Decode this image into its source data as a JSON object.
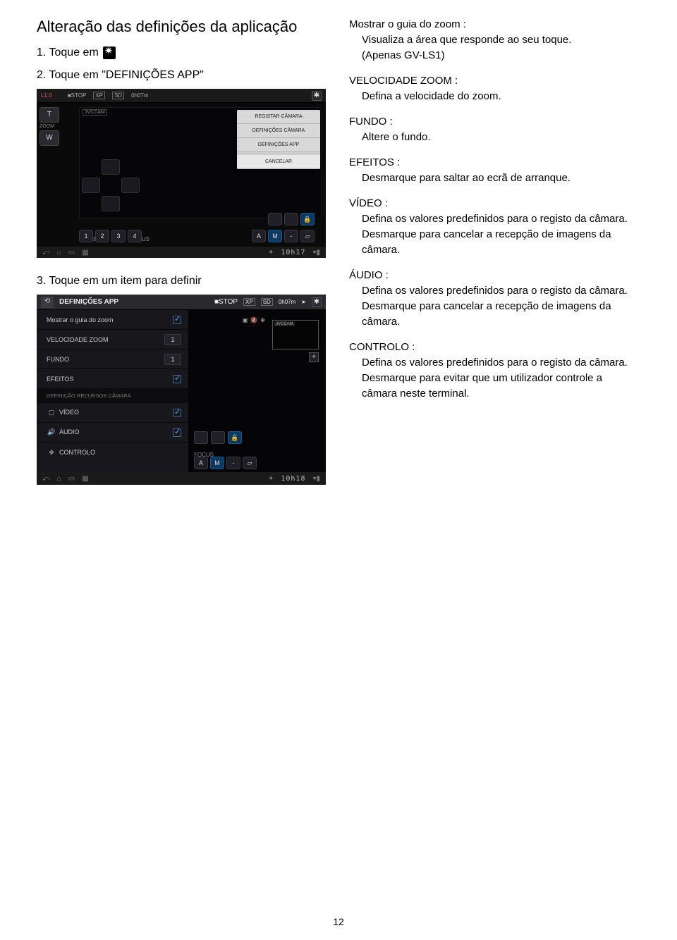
{
  "left": {
    "title": "Alteração das definições da aplicação",
    "step1_prefix": "1. Toque em",
    "step2": "2. Toque em \"DEFINIÇÕES APP\"",
    "step3": "3. Toque em um item para definir"
  },
  "shot1": {
    "topbar": {
      "l1": "L1.0",
      "stop": "■STOP",
      "xp": "XP",
      "sd": "SD",
      "t": "0h07m",
      "jvc": "JVCCAM"
    },
    "zoomT": "T",
    "zoomW": "W",
    "zoomLbl": "ZOOM",
    "preset": "PRESET",
    "focus": "FOCUS",
    "a": "A",
    "m": "M",
    "menu": {
      "reg": "REGISTAR CÂMARA",
      "camdef": "DEFINIÇÕES CÂMARA",
      "appdef": "DEFINIÇÕES APP",
      "cancel": "CANCELAR"
    },
    "lock": "🔒",
    "clock": "10h17"
  },
  "shot2": {
    "headerTitle": "DEFINIÇÕES APP",
    "topbar": {
      "stop": "■STOP",
      "xp": "XP",
      "sd": "SD",
      "t": "0h07m",
      "jvc": "JVCCAM"
    },
    "rows": {
      "r1": {
        "label": "Mostrar o guia do zoom"
      },
      "r2": {
        "label": "VELOCIDADE ZOOM",
        "val": "1"
      },
      "r3": {
        "label": "FUNDO",
        "val": "1"
      },
      "r4": {
        "label": "EFEITOS"
      },
      "sec": "DEFINIÇÃO RECURSOS CÂMARA",
      "r5": {
        "ico": "▢",
        "label": "VÍDEO"
      },
      "r6": {
        "ico": "🔊",
        "label": "ÁUDIO"
      },
      "r7": {
        "ico": "✥",
        "label": "CONTROLO"
      }
    },
    "focus": "FOCUS",
    "a": "A",
    "m": "M",
    "lock": "🔒",
    "plus": "+",
    "clock": "10h18"
  },
  "defs": {
    "d1": {
      "t": "Mostrar o guia do zoom :",
      "b1": "Visualiza a área que responde ao seu toque.",
      "b2": "(Apenas GV-LS1)"
    },
    "d2": {
      "t": "VELOCIDADE ZOOM :",
      "b1": "Defina a velocidade do zoom."
    },
    "d3": {
      "t": "FUNDO :",
      "b1": "Altere o fundo."
    },
    "d4": {
      "t": "EFEITOS :",
      "b1": "Desmarque para saltar ao ecrã de arranque."
    },
    "d5": {
      "t": "VÍDEO :",
      "b1": "Defina os valores predefinidos para o registo da câmara.",
      "b2": "Desmarque para cancelar a recepção de imagens da câmara."
    },
    "d6": {
      "t": "ÁUDIO :",
      "b1": "Defina os valores predefinidos para o registo da câmara.",
      "b2": "Desmarque para cancelar a recepção de imagens da câmara."
    },
    "d7": {
      "t": "CONTROLO :",
      "b1": "Defina os valores predefinidos para o registo da câmara.",
      "b2": "Desmarque para evitar que um utilizador controle a câmara neste terminal."
    }
  },
  "pageNum": "12"
}
